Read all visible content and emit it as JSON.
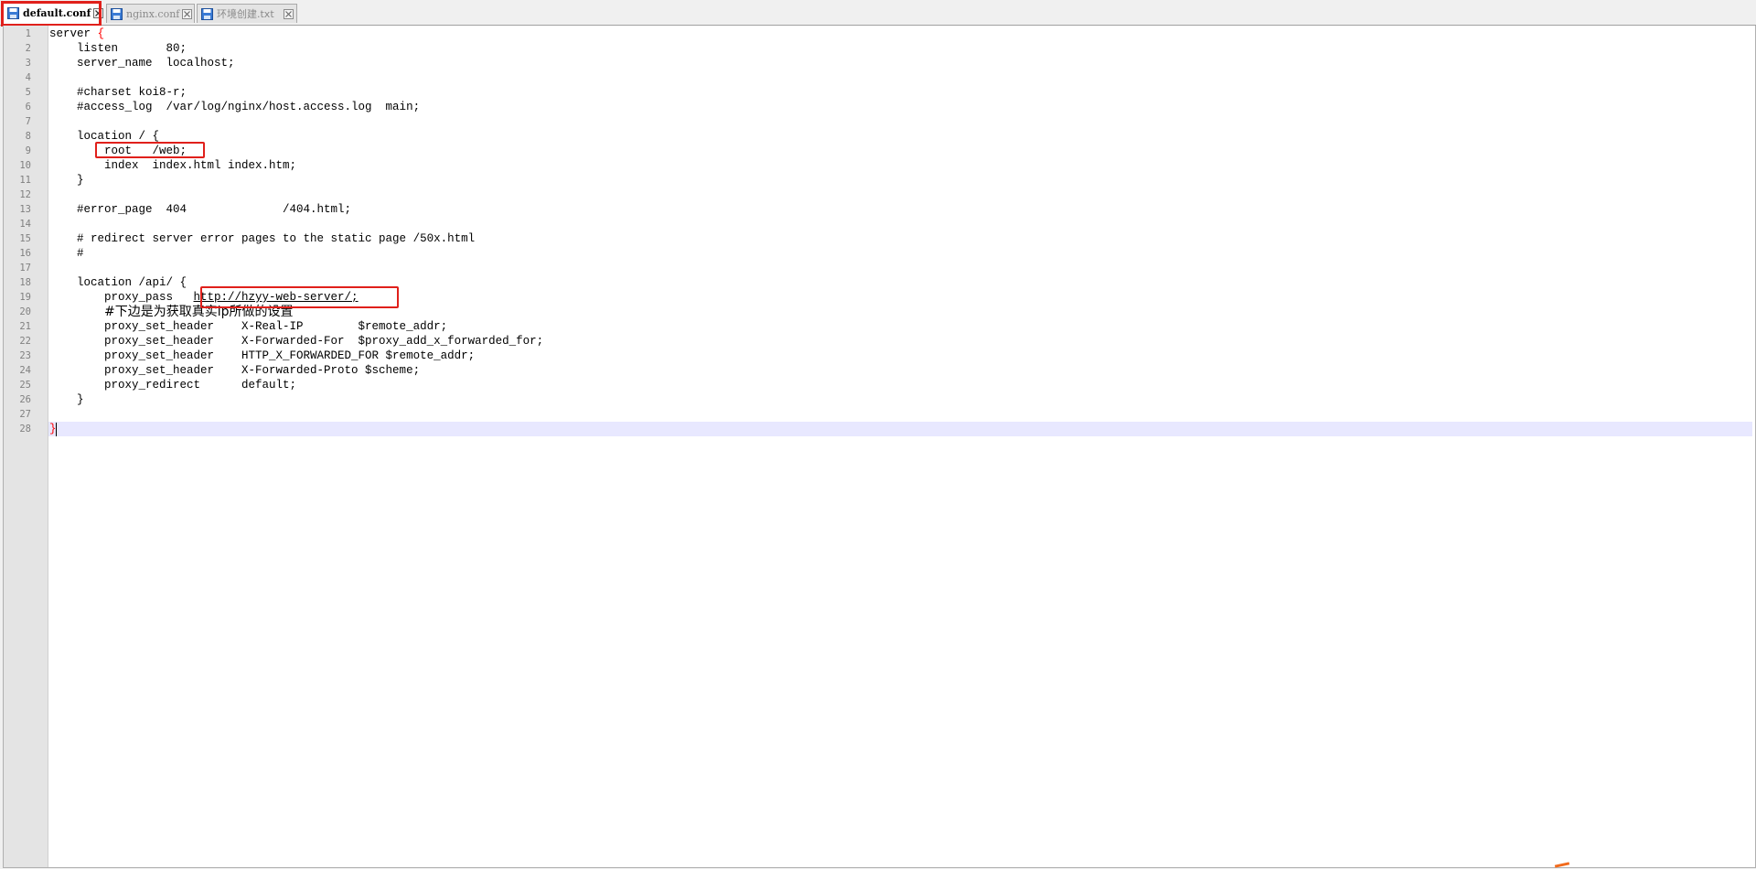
{
  "tabs": [
    {
      "label": "default.conf",
      "active": true,
      "icon": "save-disk-icon"
    },
    {
      "label": "nginx.conf",
      "active": false,
      "icon": "save-disk-icon"
    },
    {
      "label": "环境创建.txt",
      "active": false,
      "icon": "save-disk-icon"
    }
  ],
  "editor": {
    "line_numbers": [
      "1",
      "2",
      "3",
      "4",
      "5",
      "6",
      "7",
      "8",
      "9",
      "10",
      "11",
      "12",
      "13",
      "14",
      "15",
      "16",
      "17",
      "18",
      "19",
      "20",
      "21",
      "22",
      "23",
      "24",
      "25",
      "26",
      "27",
      "28"
    ],
    "lines": [
      "server ",
      "    listen       80;",
      "    server_name  localhost;",
      "",
      "    #charset koi8-r;",
      "    #access_log  /var/log/nginx/host.access.log  main;",
      "",
      "    location / {",
      "        root   /web;",
      "        index  index.html index.htm;",
      "    }",
      "",
      "    #error_page  404              /404.html;",
      "",
      "    # redirect server error pages to the static page /50x.html",
      "    #",
      "",
      "    location /api/ {",
      "        proxy_pass   ",
      "        ",
      "        proxy_set_header    X-Real-IP        $remote_addr;",
      "        proxy_set_header    X-Forwarded-For  $proxy_add_x_forwarded_for;",
      "        proxy_set_header    HTTP_X_FORWARDED_FOR $remote_addr;",
      "        proxy_set_header    X-Forwarded-Proto $scheme;",
      "        proxy_redirect      default;",
      "    }",
      "",
      ""
    ],
    "line1_brace": "{",
    "line28_brace": "}",
    "proxy_pass_url": "http://hzyy-web-server/;",
    "line20_comment": "#下边是为获取真实ip所做的设置",
    "current_line": "28"
  },
  "colors": {
    "annotation": "#e0201b",
    "brace": "#ff0000",
    "current_line_bg": "#e8e8ff",
    "gutter_bg": "#e4e4e4"
  }
}
